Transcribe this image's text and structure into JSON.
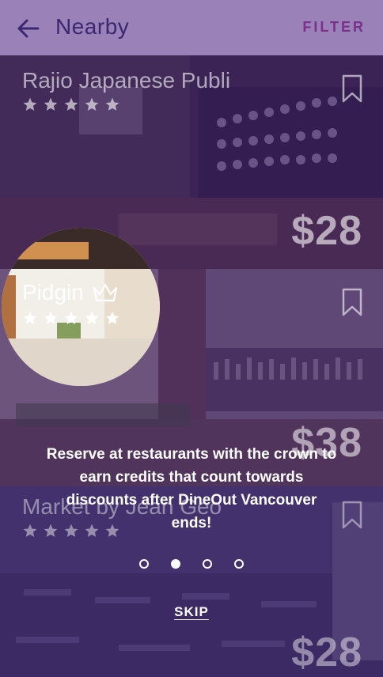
{
  "header": {
    "title": "Nearby",
    "filter_label": "FILTER"
  },
  "restaurants": [
    {
      "name": "Rajio Japanese Publi",
      "rating": 5,
      "price": "$28",
      "crown": false
    },
    {
      "name": "Pidgin",
      "rating": 5,
      "price": "$38",
      "crown": true
    },
    {
      "name": "Market by Jean Geo",
      "rating": 5,
      "price": "$28",
      "crown": false
    }
  ],
  "coach_mark": {
    "text": "Reserve at restaurants with the crown to earn credits that count towards discounts after DineOut Vancouver ends!",
    "page_count": 4,
    "active_page": 2,
    "skip_label": "SKIP"
  },
  "colors": {
    "header_bg": "#9a82b8",
    "title_color": "#3c2870",
    "filter_color": "#7a2f88",
    "overlay": "#3c1e6e"
  },
  "icons": [
    "back-arrow-icon",
    "bookmark-icon",
    "star-icon",
    "crown-icon"
  ]
}
